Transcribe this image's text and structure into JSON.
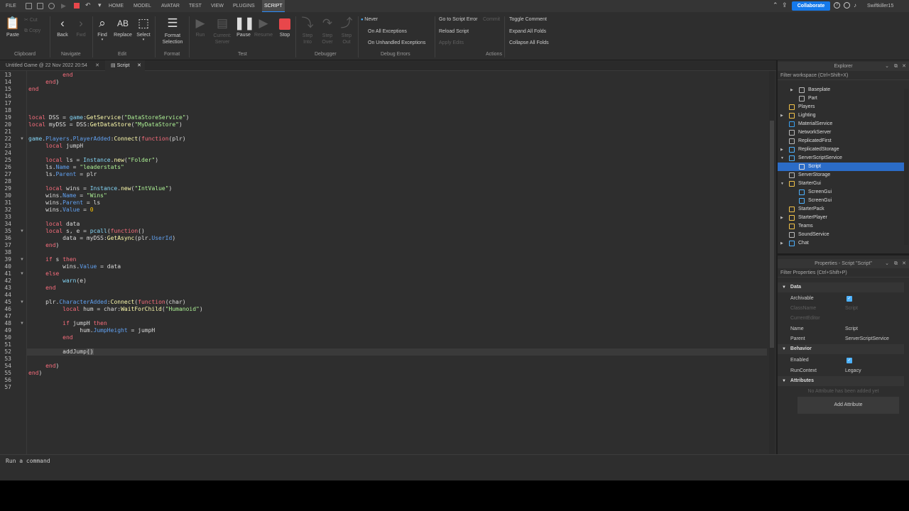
{
  "menu": {
    "file": "FILE",
    "tabs": [
      "HOME",
      "MODEL",
      "AVATAR",
      "TEST",
      "VIEW",
      "PLUGINS",
      "SCRIPT"
    ],
    "active_tab": "SCRIPT",
    "collaborate": "Collaborate",
    "username": "Swiftkiller15"
  },
  "ribbon": {
    "paste": "Paste",
    "cut": "Cut",
    "copy": "Copy",
    "back": "Back",
    "fwd": "Fwd",
    "find": "Find",
    "replace": "Replace",
    "select": "Select",
    "format_selection": "Format Selection",
    "run": "Run",
    "current_server": "Current: Server",
    "pause": "Pause",
    "resume": "Resume",
    "stop": "Stop",
    "step_into": "Step Into",
    "step_over": "Step Over",
    "step_out": "Step Out",
    "never": "Never",
    "on_all_exceptions": "On All Exceptions",
    "on_unhandled_exceptions": "On Unhandled Exceptions",
    "go_to_script_error": "Go to Script Error",
    "commit": "Commit",
    "reload_script": "Reload Script",
    "apply_edits": "Apply Edits",
    "toggle_comment": "Toggle Comment",
    "expand_all_folds": "Expand All Folds",
    "collapse_all_folds": "Collapse All Folds",
    "groups": {
      "clipboard": "Clipboard",
      "navigate": "Navigate",
      "edit": "Edit",
      "format": "Format",
      "test": "Test",
      "debugger": "Debugger",
      "debug_errors": "Debug Errors",
      "actions": "Actions"
    }
  },
  "tabs": [
    {
      "label": "Untitled Game @ 22 Nov 2022 20:54"
    },
    {
      "label": "Script"
    }
  ],
  "editor": {
    "line_numbers": [
      "13",
      "14",
      "15",
      "16",
      "17",
      "18",
      "19",
      "20",
      "21",
      "22",
      "23",
      "24",
      "25",
      "26",
      "27",
      "28",
      "29",
      "30",
      "31",
      "32",
      "33",
      "34",
      "35",
      "36",
      "37",
      "38",
      "39",
      "40",
      "41",
      "42",
      "43",
      "44",
      "45",
      "46",
      "47",
      "48",
      "49",
      "50",
      "51",
      "52",
      "53",
      "54",
      "55",
      "56",
      "57"
    ],
    "current_line": "52"
  },
  "command_bar": {
    "placeholder": "Run a command"
  },
  "explorer": {
    "title": "Explorer",
    "filter": "Filter workspace (Ctrl+Shift+X)",
    "items": [
      {
        "label": "Baseplate",
        "icon": "part-icon"
      },
      {
        "label": "Part",
        "icon": "part-icon"
      },
      {
        "label": "Players",
        "icon": "players-icon"
      },
      {
        "label": "Lighting",
        "icon": "lighting-icon"
      },
      {
        "label": "MaterialService",
        "icon": "material-service-icon"
      },
      {
        "label": "NetworkServer",
        "icon": "network-server-icon"
      },
      {
        "label": "ReplicatedFirst",
        "icon": "replicated-first-icon"
      },
      {
        "label": "ReplicatedStorage",
        "icon": "replicated-storage-icon"
      },
      {
        "label": "ServerScriptService",
        "icon": "server-script-service-icon"
      },
      {
        "label": "Script",
        "icon": "script-icon"
      },
      {
        "label": "ServerStorage",
        "icon": "server-storage-icon"
      },
      {
        "label": "StarterGui",
        "icon": "starter-gui-icon"
      },
      {
        "label": "ScreenGui",
        "icon": "screen-gui-icon"
      },
      {
        "label": "ScreenGui",
        "icon": "screen-gui-icon"
      },
      {
        "label": "StarterPack",
        "icon": "starter-pack-icon"
      },
      {
        "label": "StarterPlayer",
        "icon": "starter-player-icon"
      },
      {
        "label": "Teams",
        "icon": "teams-icon"
      },
      {
        "label": "SoundService",
        "icon": "sound-service-icon"
      },
      {
        "label": "Chat",
        "icon": "chat-icon"
      }
    ]
  },
  "properties": {
    "title": "Properties - Script \"Script\"",
    "filter": "Filter Properties (Ctrl+Shift+P)",
    "data_cat": "Data",
    "archivable": "Archivable",
    "class_name": "ClassName",
    "class_name_val": "Script",
    "current_editor": "CurrentEditor",
    "name": "Name",
    "name_val": "Script",
    "parent": "Parent",
    "parent_val": "ServerScriptService",
    "behavior_cat": "Behavior",
    "enabled": "Enabled",
    "run_context": "RunContext",
    "run_context_val": "Legacy",
    "attributes_cat": "Attributes",
    "no_attr": "No Attribute has been added yet",
    "add_attr": "Add Attribute"
  },
  "colors": {
    "accent": "#1579ea",
    "selection": "#2b6cc7",
    "stop": "#e8474b",
    "keyword": "#f86d7c",
    "builtin": "#84d6f7",
    "string": "#adf195",
    "number": "#ffc600",
    "property": "#61a1f1",
    "method": "#fdfbac"
  }
}
